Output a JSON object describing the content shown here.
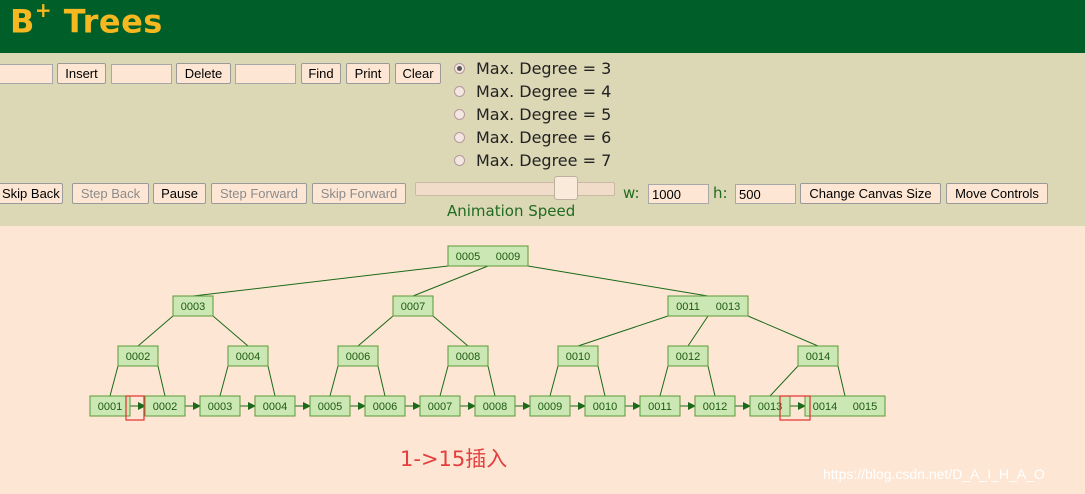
{
  "header": {
    "title": "B",
    "title_sup": "+",
    "title_rest": " Trees"
  },
  "toolbar": {
    "insert_label": "Insert",
    "delete_label": "Delete",
    "find_label": "Find",
    "print_label": "Print",
    "clear_label": "Clear"
  },
  "degree_options": [
    {
      "label": "Max. Degree = 3",
      "selected": true
    },
    {
      "label": "Max. Degree = 4",
      "selected": false
    },
    {
      "label": "Max. Degree = 5",
      "selected": false
    },
    {
      "label": "Max. Degree = 6",
      "selected": false
    },
    {
      "label": "Max. Degree = 7",
      "selected": false
    }
  ],
  "animation": {
    "skip_back": "Skip Back",
    "step_back": "Step Back",
    "pause": "Pause",
    "step_forward": "Step Forward",
    "skip_forward": "Skip Forward",
    "speed_label": "Animation Speed",
    "speed_fraction": 0.75
  },
  "canvas": {
    "w_label": "w:",
    "w_value": "1000",
    "h_label": "h:",
    "h_value": "500",
    "change_size_label": "Change Canvas Size",
    "move_controls_label": "Move Controls"
  },
  "tree": {
    "root": [
      "0005",
      "0009"
    ],
    "level1": [
      [
        "0003"
      ],
      [
        "0007"
      ],
      [
        "0011",
        "0013"
      ]
    ],
    "level2": [
      [
        "0002"
      ],
      [
        "0004"
      ],
      [
        "0006"
      ],
      [
        "0008"
      ],
      [
        "0010"
      ],
      [
        "0012"
      ],
      [
        "0014"
      ]
    ],
    "leaves": [
      [
        "0001"
      ],
      [
        "0002"
      ],
      [
        "0003"
      ],
      [
        "0004"
      ],
      [
        "0005"
      ],
      [
        "0006"
      ],
      [
        "0007"
      ],
      [
        "0008"
      ],
      [
        "0009"
      ],
      [
        "0010"
      ],
      [
        "0011"
      ],
      [
        "0012"
      ],
      [
        "0013"
      ],
      [
        "0014",
        "0015"
      ]
    ]
  },
  "caption": "1->15插入",
  "watermark": "https://blog.csdn.net/D_A_I_H_A_O"
}
